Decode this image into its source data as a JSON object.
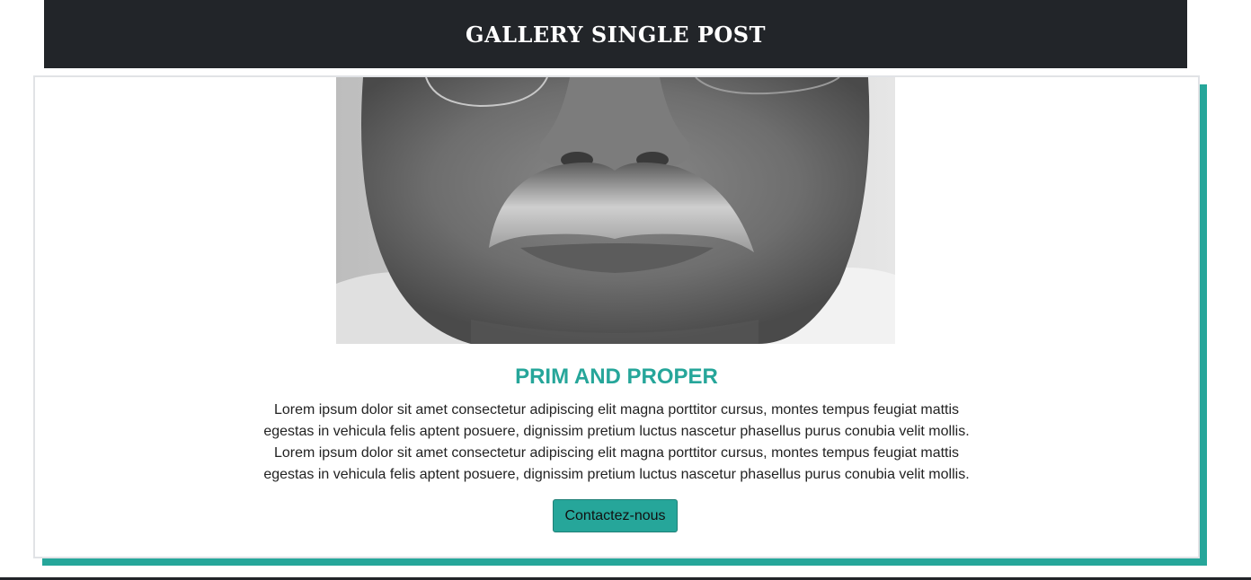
{
  "header": {
    "title": "GALLERY SINGLE POST"
  },
  "post": {
    "image_alt": "Close-up black and white portrait of a man with a grey mustache",
    "title": "PRIM AND PROPER",
    "body": "Lorem ipsum dolor sit amet consectetur adipiscing elit magna porttitor cursus, montes tempus feugiat mattis egestas in vehicula felis aptent posuere, dignissim pretium luctus nascetur phasellus purus conubia velit mollis. Lorem ipsum dolor sit amet consectetur adipiscing elit magna porttitor cursus, montes tempus feugiat mattis egestas in vehicula felis aptent posuere, dignissim pretium luctus nascetur phasellus purus conubia velit mollis.",
    "button_label": "Contactez-nous"
  },
  "colors": {
    "accent": "#26a69a",
    "header_bg": "#222529",
    "card_border": "#e1e3e6"
  }
}
